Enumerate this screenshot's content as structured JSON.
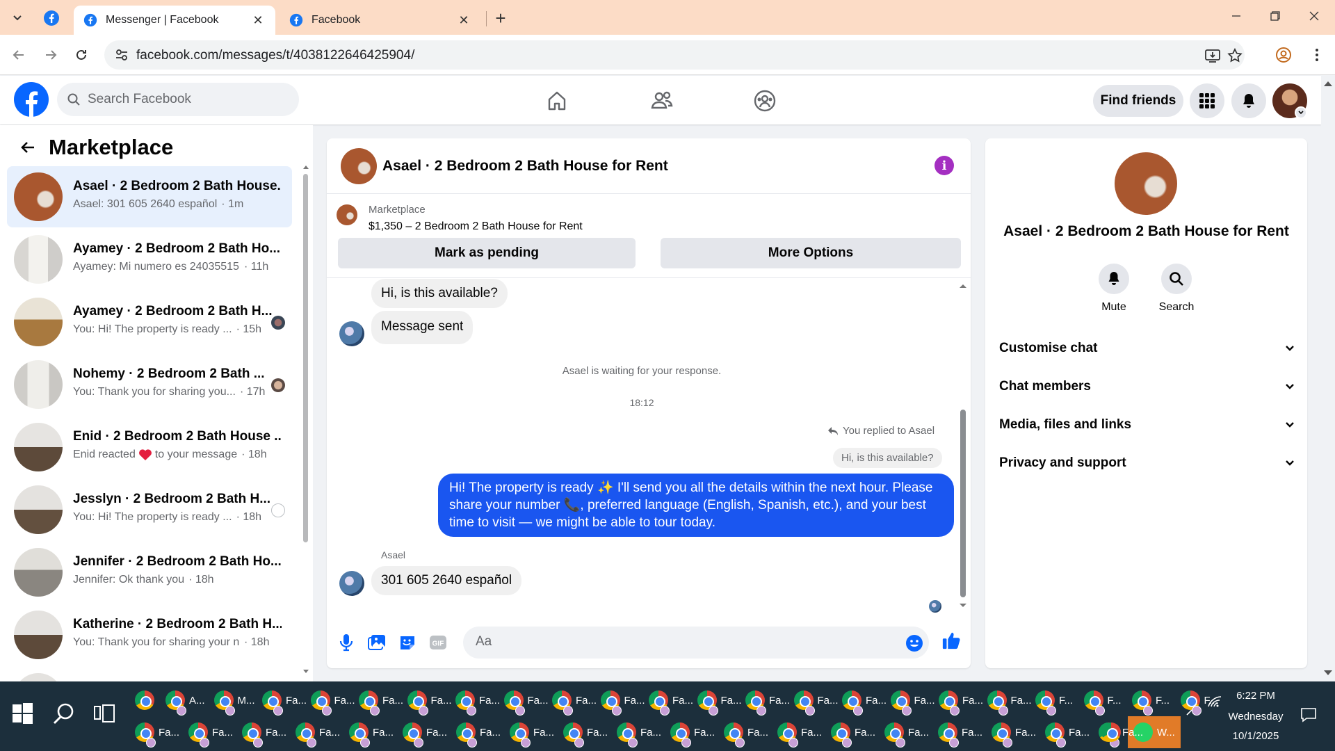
{
  "browser": {
    "tabs": [
      {
        "title": "Messenger | Facebook",
        "active": true
      },
      {
        "title": "Facebook",
        "active": false
      }
    ],
    "url": "facebook.com/messages/t/4038122646425904/"
  },
  "header": {
    "search_placeholder": "Search Facebook",
    "find_friends": "Find friends"
  },
  "sidebar": {
    "title": "Marketplace",
    "conversations": [
      {
        "title": "Asael · 2 Bedroom 2 Bath House...",
        "preview": "Asael: 301 605 2640 español",
        "time": "· 1m",
        "selected": true
      },
      {
        "title": "Ayamey · 2 Bedroom 2 Bath Ho...",
        "preview": "Ayamey: Mi numero es 24035515...",
        "time": "· 11h"
      },
      {
        "title": "Ayamey · 2 Bedroom 2 Bath H...",
        "preview": "You: Hi! The property is ready ...",
        "time": "· 15h"
      },
      {
        "title": "Nohemy · 2 Bedroom 2 Bath ...",
        "preview": "You: Thank you for sharing you...",
        "time": "· 17h"
      },
      {
        "title": "Enid · 2 Bedroom 2 Bath House ...",
        "preview_before": "Enid reacted",
        "preview_after": "to your message",
        "time": "· 18h"
      },
      {
        "title": "Jesslyn · 2 Bedroom 2 Bath H...",
        "preview": "You: Hi! The property is ready ...",
        "time": "· 18h"
      },
      {
        "title": "Jennifer · 2 Bedroom 2 Bath Ho...",
        "preview": "Jennifer: Ok thank you",
        "time": "· 18h"
      },
      {
        "title": "Katherine · 2 Bedroom 2 Bath H...",
        "preview": "You: Thank you for sharing your n...",
        "time": "· 18h"
      }
    ]
  },
  "chat": {
    "title": "Asael · 2 Bedroom 2 Bath House for Rent",
    "marketplace_label": "Marketplace",
    "listing": "$1,350 – 2 Bedroom 2 Bath House for Rent",
    "mark_pending": "Mark as pending",
    "more_options": "More Options",
    "messages": {
      "m1": "Hi, is this available?",
      "m2": "Message sent",
      "waiting": "Asael is waiting for your response.",
      "timestamp": "18:12",
      "replied_to": "You replied to Asael",
      "quoted": "Hi, is this available?",
      "mine_a": "Hi! The property is ready ",
      "mine_b": " I'll send you all the details within the next hour. Please share your number ",
      "mine_c": ", preferred language (English, Spanish, etc.), and your best time to visit — we might be able to tour today.",
      "sender": "Asael",
      "last": "301 605 2640 español"
    },
    "composer_placeholder": "Aa"
  },
  "details": {
    "title": "Asael · 2 Bedroom 2 Bath House for Rent",
    "mute": "Mute",
    "search": "Search",
    "rows": [
      "Customise chat",
      "Chat members",
      "Media, files and links",
      "Privacy and support"
    ]
  },
  "taskbar": {
    "row1": [
      "A...",
      "M...",
      "Fa...",
      "Fa...",
      "Fa...",
      "Fa...",
      "Fa...",
      "Fa...",
      "Fa...",
      "Fa...",
      "Fa...",
      "Fa...",
      "Fa...",
      "Fa...",
      "Fa...",
      "Fa...",
      "Fa...",
      "Fa...",
      "F...",
      "F...",
      "F...",
      "F..."
    ],
    "row2": [
      "Fa...",
      "Fa...",
      "Fa...",
      "Fa...",
      "Fa...",
      "Fa...",
      "Fa...",
      "Fa...",
      "Fa...",
      "Fa...",
      "Fa...",
      "Fa...",
      "Fa...",
      "Fa...",
      "Fa...",
      "Fa...",
      "Fa...",
      "Fa...",
      "Fa..."
    ],
    "whatsapp": "W...",
    "time": "6:22 PM",
    "day": "Wednesday",
    "date": "10/1/2025"
  }
}
